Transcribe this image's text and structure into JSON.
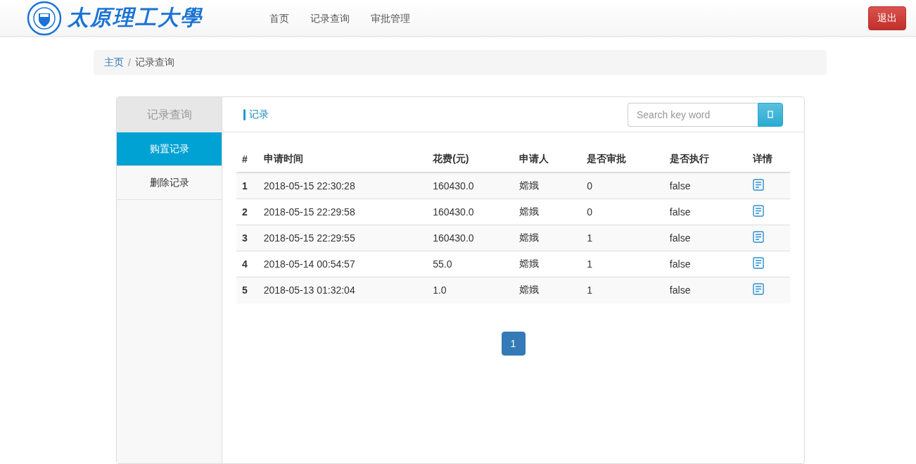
{
  "navbar": {
    "logo_text": "太原理工大學",
    "links": [
      {
        "label": "首页"
      },
      {
        "label": "记录查询"
      },
      {
        "label": "审批管理"
      }
    ],
    "logout": "退出"
  },
  "breadcrumb": {
    "items": [
      "主页",
      "记录查询"
    ],
    "separator": "/"
  },
  "sidebar": {
    "title": "记录查询",
    "items": [
      {
        "label": "购置记录",
        "selected": true
      },
      {
        "label": "删除记录",
        "selected": false
      }
    ]
  },
  "panel": {
    "title": "记录",
    "search": {
      "placeholder": "Search key word"
    }
  },
  "table": {
    "columns": [
      "#",
      "申请时间",
      "花费(元)",
      "申请人",
      "是否审批",
      "是否执行",
      "详情"
    ],
    "rows": [
      {
        "cells": [
          "1",
          "2018-05-15 22:30:28",
          "160430.0",
          "嫦娥",
          "0",
          "false"
        ]
      },
      {
        "cells": [
          "2",
          "2018-05-15 22:29:58",
          "160430.0",
          "嫦娥",
          "0",
          "false"
        ]
      },
      {
        "cells": [
          "3",
          "2018-05-15 22:29:55",
          "160430.0",
          "嫦娥",
          "1",
          "false"
        ]
      },
      {
        "cells": [
          "4",
          "2018-05-14 00:54:57",
          "55.0",
          "嫦娥",
          "1",
          "false"
        ]
      },
      {
        "cells": [
          "5",
          "2018-05-13 01:32:04",
          "1.0",
          "嫦娥",
          "1",
          "false"
        ]
      }
    ]
  },
  "pagination": [
    {
      "label": "1",
      "selected": true
    }
  ]
}
